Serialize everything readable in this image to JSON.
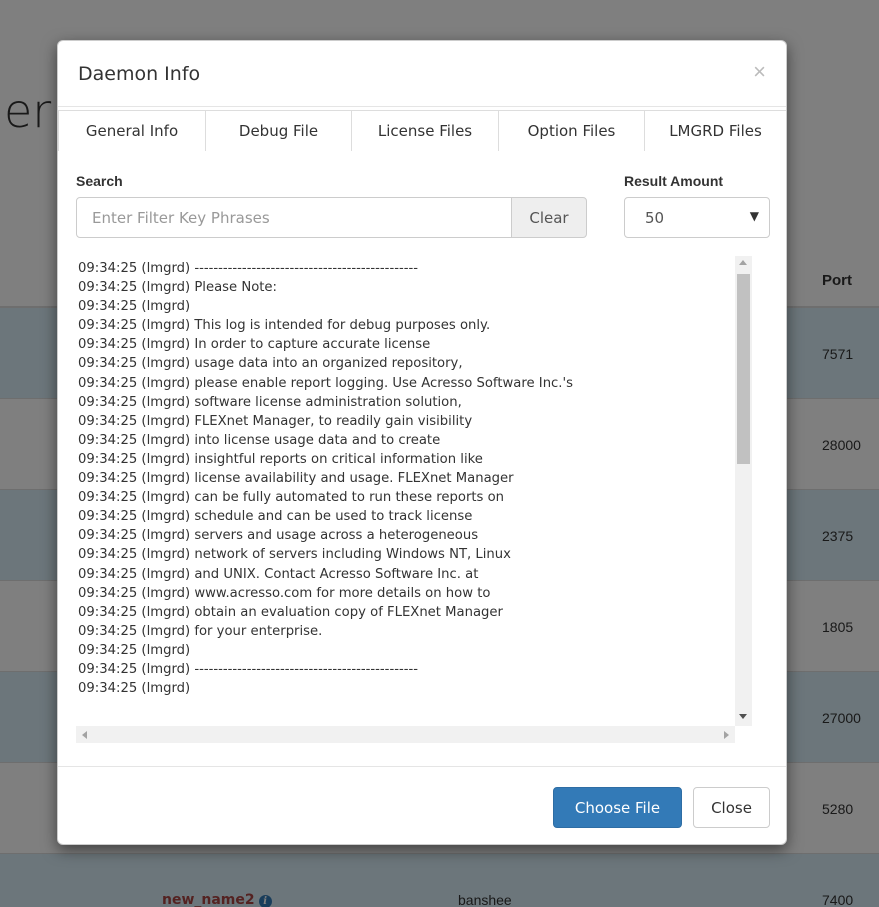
{
  "background": {
    "title_fragment": "er",
    "port_header": "Port",
    "rows": [
      {
        "port": "7571"
      },
      {
        "port": "28000"
      },
      {
        "port": "2375"
      },
      {
        "port": "1805"
      },
      {
        "port": "27000"
      },
      {
        "port": "5280"
      },
      {
        "name": "new_name2",
        "host": "banshee",
        "port": "7400"
      }
    ]
  },
  "modal": {
    "title": "Daemon Info",
    "close_icon": "×",
    "tabs": [
      {
        "label": "General Info"
      },
      {
        "label": "Debug File"
      },
      {
        "label": "License Files"
      },
      {
        "label": "Option Files"
      },
      {
        "label": "LMGRD Files"
      }
    ],
    "search": {
      "label": "Search",
      "placeholder": "Enter Filter Key Phrases",
      "clear_label": "Clear"
    },
    "result_amount": {
      "label": "Result Amount",
      "selected": "50"
    },
    "log_lines": [
      "09:34:25 (lmgrd) -----------------------------------------------",
      "09:34:25 (lmgrd) Please Note:",
      "09:34:25 (lmgrd)",
      "09:34:25 (lmgrd) This log is intended for debug purposes only.",
      "09:34:25 (lmgrd) In order to capture accurate license",
      "09:34:25 (lmgrd) usage data into an organized repository,",
      "09:34:25 (lmgrd) please enable report logging. Use Acresso Software Inc.'s",
      "09:34:25 (lmgrd) software license administration solution,",
      "09:34:25 (lmgrd) FLEXnet Manager, to readily gain visibility",
      "09:34:25 (lmgrd) into license usage data and to create",
      "09:34:25 (lmgrd) insightful reports on critical information like",
      "09:34:25 (lmgrd) license availability and usage. FLEXnet Manager",
      "09:34:25 (lmgrd) can be fully automated to run these reports on",
      "09:34:25 (lmgrd) schedule and can be used to track license",
      "09:34:25 (lmgrd) servers and usage across a heterogeneous",
      "09:34:25 (lmgrd) network of servers including Windows NT, Linux",
      "09:34:25 (lmgrd) and UNIX. Contact Acresso Software Inc. at",
      "09:34:25 (lmgrd) www.acresso.com for more details on how to",
      "09:34:25 (lmgrd) obtain an evaluation copy of FLEXnet Manager",
      "09:34:25 (lmgrd) for your enterprise.",
      "09:34:25 (lmgrd)",
      "09:34:25 (lmgrd) -----------------------------------------------",
      "09:34:25 (lmgrd)"
    ],
    "footer": {
      "choose_file_label": "Choose File",
      "close_label": "Close"
    }
  }
}
